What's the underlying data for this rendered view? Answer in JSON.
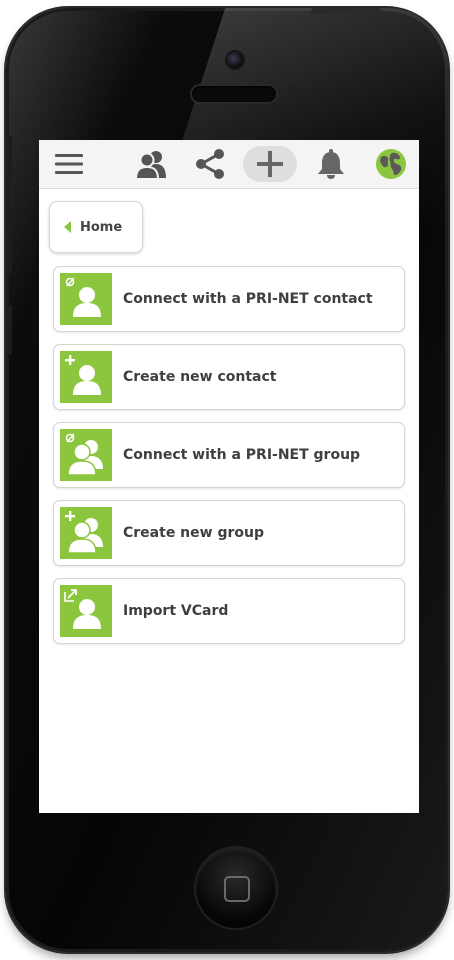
{
  "toolbar": {
    "icons": [
      "menu-icon",
      "contacts-icon",
      "share-icon",
      "add-icon",
      "bell-icon",
      "globe-icon"
    ]
  },
  "nav": {
    "home_label": "Home"
  },
  "menu": {
    "items": [
      {
        "label": "Connect with a PRI-NET contact",
        "icon": "connect-contact-icon"
      },
      {
        "label": "Create new contact",
        "icon": "add-contact-icon"
      },
      {
        "label": "Connect with a PRI-NET group",
        "icon": "connect-group-icon"
      },
      {
        "label": "Create new group",
        "icon": "add-group-icon"
      },
      {
        "label": "Import VCard",
        "icon": "import-vcard-icon"
      }
    ]
  },
  "colors": {
    "accent": "#8cc63f",
    "text": "#3f3f3f",
    "toolbar_bg": "#f4f4f4",
    "icon_gray": "#555555"
  }
}
